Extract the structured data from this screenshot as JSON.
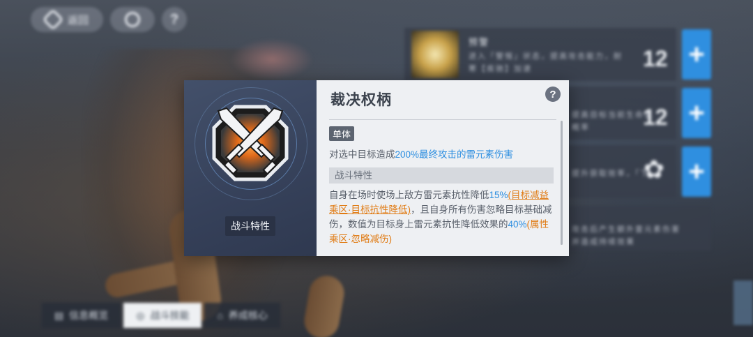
{
  "topbar": {
    "back_label": "返回",
    "help_glyph": "?"
  },
  "background_list": {
    "rows": [
      {
        "title": "预警",
        "text_line1": "进入「警惕」状态，提高攻击能力，耐",
        "text_line2": "寒【疾驰】加速",
        "level": "12"
      },
      {
        "text_line1": "提高目标当前生命值",
        "text_line2": "概率",
        "level": "12"
      },
      {
        "text_line1": "提升获取效率，「下"
      },
      {
        "text_line1": "攻击后产生额外雷元素伤害",
        "text_line2": "并造成持续效果"
      }
    ],
    "plus_glyph": "+"
  },
  "bottom_tabs": [
    {
      "label": "信息概览",
      "active": false
    },
    {
      "label": "战斗技能",
      "active": true
    },
    {
      "label": "养成核心",
      "active": false
    }
  ],
  "modal": {
    "trait_tag": "战斗特性",
    "title": "裁决权柄",
    "help_glyph": "?",
    "target_badge": "单体",
    "desc1": {
      "prefix": "对选中目标造成",
      "percent": "200%",
      "suffix": "最终攻击的雷元素伤害"
    },
    "section_header": "战斗特性",
    "desc2": {
      "p1": "自身在场时使场上敌方雷元素抗性降低",
      "v1": "15%",
      "link1": "(目标减益乘区·目标抗性降低)",
      "p2": "，且自身所有伤害忽略目标基础减伤，数值为目标身上雷元素抗性降低效果的",
      "v2": "40%",
      "link2": "(属性乘区·忽略减伤)"
    }
  },
  "colors": {
    "accent_blue": "#2c8ee0",
    "accent_orange": "#e07a12",
    "emblem_orange": "#f08a2a"
  },
  "icons": {
    "emblem": "crossed-swords-icon",
    "help": "question-icon",
    "plus": "plus-icon"
  }
}
